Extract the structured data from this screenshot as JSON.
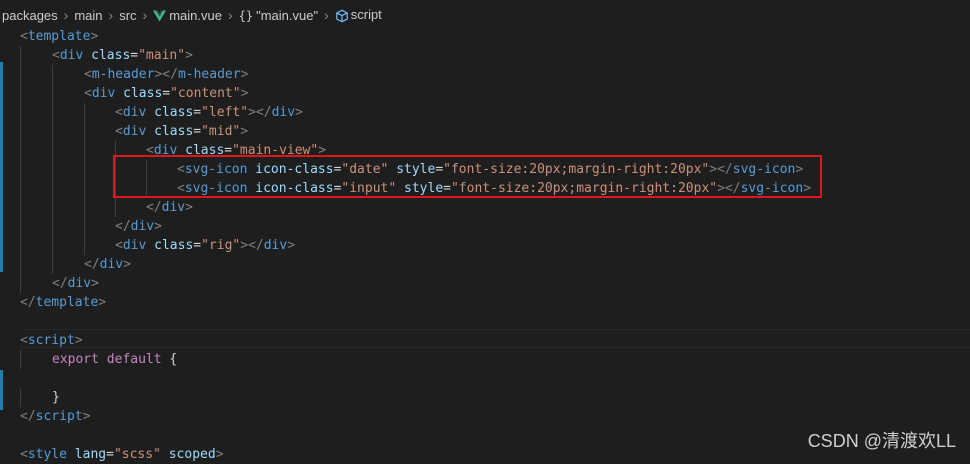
{
  "breadcrumb": {
    "segments": [
      "packages",
      "main",
      "src",
      "main.vue",
      "{}",
      "\"main.vue\"",
      "script"
    ],
    "icons": {
      "vue": "vue-icon",
      "object": "braces-icon",
      "module": "cube-icon"
    }
  },
  "editor": {
    "lines": [
      {
        "indent": 20,
        "parts": [
          [
            "br",
            "<"
          ],
          [
            "tag",
            "template"
          ],
          [
            "br",
            ">"
          ]
        ]
      },
      {
        "indent": 52,
        "parts": [
          [
            "br",
            "<"
          ],
          [
            "tag",
            "div"
          ],
          [
            "punc",
            " "
          ],
          [
            "attr",
            "class"
          ],
          [
            "punc",
            "="
          ],
          [
            "str",
            "\"main\""
          ],
          [
            "br",
            ">"
          ]
        ]
      },
      {
        "indent": 84,
        "parts": [
          [
            "br",
            "<"
          ],
          [
            "tag",
            "m-header"
          ],
          [
            "br",
            "></"
          ],
          [
            "tag",
            "m-header"
          ],
          [
            "br",
            ">"
          ]
        ]
      },
      {
        "indent": 84,
        "parts": [
          [
            "br",
            "<"
          ],
          [
            "tag",
            "div"
          ],
          [
            "punc",
            " "
          ],
          [
            "attr",
            "class"
          ],
          [
            "punc",
            "="
          ],
          [
            "str",
            "\"content\""
          ],
          [
            "br",
            ">"
          ]
        ]
      },
      {
        "indent": 115,
        "parts": [
          [
            "br",
            "<"
          ],
          [
            "tag",
            "div"
          ],
          [
            "punc",
            " "
          ],
          [
            "attr",
            "class"
          ],
          [
            "punc",
            "="
          ],
          [
            "str",
            "\"left\""
          ],
          [
            "br",
            "></"
          ],
          [
            "tag",
            "div"
          ],
          [
            "br",
            ">"
          ]
        ]
      },
      {
        "indent": 115,
        "parts": [
          [
            "br",
            "<"
          ],
          [
            "tag",
            "div"
          ],
          [
            "punc",
            " "
          ],
          [
            "attr",
            "class"
          ],
          [
            "punc",
            "="
          ],
          [
            "str",
            "\"mid\""
          ],
          [
            "br",
            ">"
          ]
        ]
      },
      {
        "indent": 146,
        "parts": [
          [
            "br",
            "<"
          ],
          [
            "tag",
            "div"
          ],
          [
            "punc",
            " "
          ],
          [
            "attr",
            "class"
          ],
          [
            "punc",
            "="
          ],
          [
            "str",
            "\"main-view\""
          ],
          [
            "br",
            ">"
          ]
        ]
      },
      {
        "indent": 177,
        "parts": [
          [
            "br",
            "<"
          ],
          [
            "tag",
            "svg-icon"
          ],
          [
            "punc",
            " "
          ],
          [
            "attr",
            "icon-class"
          ],
          [
            "punc",
            "="
          ],
          [
            "str",
            "\"date\""
          ],
          [
            "punc",
            " "
          ],
          [
            "attr",
            "style"
          ],
          [
            "punc",
            "="
          ],
          [
            "str",
            "\"font-size:20px;margin-right:20px\""
          ],
          [
            "br",
            "></"
          ],
          [
            "tag",
            "svg-icon"
          ],
          [
            "br",
            ">"
          ]
        ]
      },
      {
        "indent": 177,
        "parts": [
          [
            "br",
            "<"
          ],
          [
            "tag",
            "svg-icon"
          ],
          [
            "punc",
            " "
          ],
          [
            "attr",
            "icon-class"
          ],
          [
            "punc",
            "="
          ],
          [
            "str",
            "\"input\""
          ],
          [
            "punc",
            " "
          ],
          [
            "attr",
            "style"
          ],
          [
            "punc",
            "="
          ],
          [
            "str",
            "\"font-size:20px;margin-right:20px\""
          ],
          [
            "br",
            "></"
          ],
          [
            "tag",
            "svg-icon"
          ],
          [
            "br",
            ">"
          ]
        ]
      },
      {
        "indent": 146,
        "parts": [
          [
            "br",
            "</"
          ],
          [
            "tag",
            "div"
          ],
          [
            "br",
            ">"
          ]
        ]
      },
      {
        "indent": 115,
        "parts": [
          [
            "br",
            "</"
          ],
          [
            "tag",
            "div"
          ],
          [
            "br",
            ">"
          ]
        ]
      },
      {
        "indent": 115,
        "parts": [
          [
            "br",
            "<"
          ],
          [
            "tag",
            "div"
          ],
          [
            "punc",
            " "
          ],
          [
            "attr",
            "class"
          ],
          [
            "punc",
            "="
          ],
          [
            "str",
            "\"rig\""
          ],
          [
            "br",
            "></"
          ],
          [
            "tag",
            "div"
          ],
          [
            "br",
            ">"
          ]
        ]
      },
      {
        "indent": 84,
        "parts": [
          [
            "br",
            "</"
          ],
          [
            "tag",
            "div"
          ],
          [
            "br",
            ">"
          ]
        ]
      },
      {
        "indent": 52,
        "parts": [
          [
            "br",
            "</"
          ],
          [
            "tag",
            "div"
          ],
          [
            "br",
            ">"
          ]
        ]
      },
      {
        "indent": 20,
        "parts": [
          [
            "br",
            "</"
          ],
          [
            "tag",
            "template"
          ],
          [
            "br",
            ">"
          ]
        ]
      },
      {
        "indent": 20,
        "parts": []
      },
      {
        "indent": 20,
        "parts": [
          [
            "br",
            "<"
          ],
          [
            "tag",
            "script"
          ],
          [
            "br",
            ">"
          ]
        ]
      },
      {
        "indent": 52,
        "parts": [
          [
            "kw",
            "export"
          ],
          [
            "punc",
            " "
          ],
          [
            "kw",
            "default"
          ],
          [
            "punc",
            " {"
          ]
        ]
      },
      {
        "indent": 52,
        "parts": []
      },
      {
        "indent": 52,
        "parts": [
          [
            "punc",
            "}"
          ]
        ]
      },
      {
        "indent": 20,
        "parts": [
          [
            "br",
            "</"
          ],
          [
            "tag",
            "script"
          ],
          [
            "br",
            ">"
          ]
        ]
      },
      {
        "indent": 20,
        "parts": []
      },
      {
        "indent": 20,
        "parts": [
          [
            "br",
            "<"
          ],
          [
            "tag",
            "style"
          ],
          [
            "punc",
            " "
          ],
          [
            "attr",
            "lang"
          ],
          [
            "punc",
            "="
          ],
          [
            "str",
            "\"scss\""
          ],
          [
            "punc",
            " "
          ],
          [
            "attr",
            "scoped"
          ],
          [
            "br",
            ">"
          ]
        ]
      }
    ]
  },
  "watermark": "CSDN @清渡欢LL"
}
